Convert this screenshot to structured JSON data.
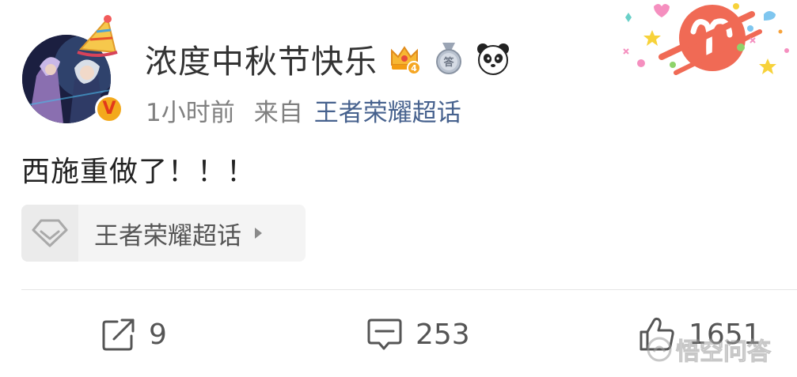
{
  "post": {
    "author": {
      "name": "浓度中秋节快乐",
      "verified_badge": "V",
      "badges": [
        "crown-level-icon",
        "answer-medal-icon",
        "panda-icon"
      ],
      "crown_level": "4",
      "answer_medal_glyph": "答"
    },
    "time": "1小时前",
    "from_label": "来自",
    "source": "王者荣耀超话",
    "text": "西施重做了！！！",
    "topic_card": {
      "icon": "super-topic-diamond-icon",
      "label": "王者荣耀超话",
      "arrow": "chevron-right-icon"
    }
  },
  "actions": {
    "repost": {
      "icon": "share-icon",
      "count": "9"
    },
    "comment": {
      "icon": "comment-icon",
      "count": "253"
    },
    "like": {
      "icon": "thumbs-up-icon",
      "count": "1651"
    }
  },
  "watermark": {
    "text": "悟空问答"
  },
  "colors": {
    "link": "#47628e",
    "meta": "#808080",
    "text": "#222222",
    "vip_badge": "#f3a91c"
  }
}
